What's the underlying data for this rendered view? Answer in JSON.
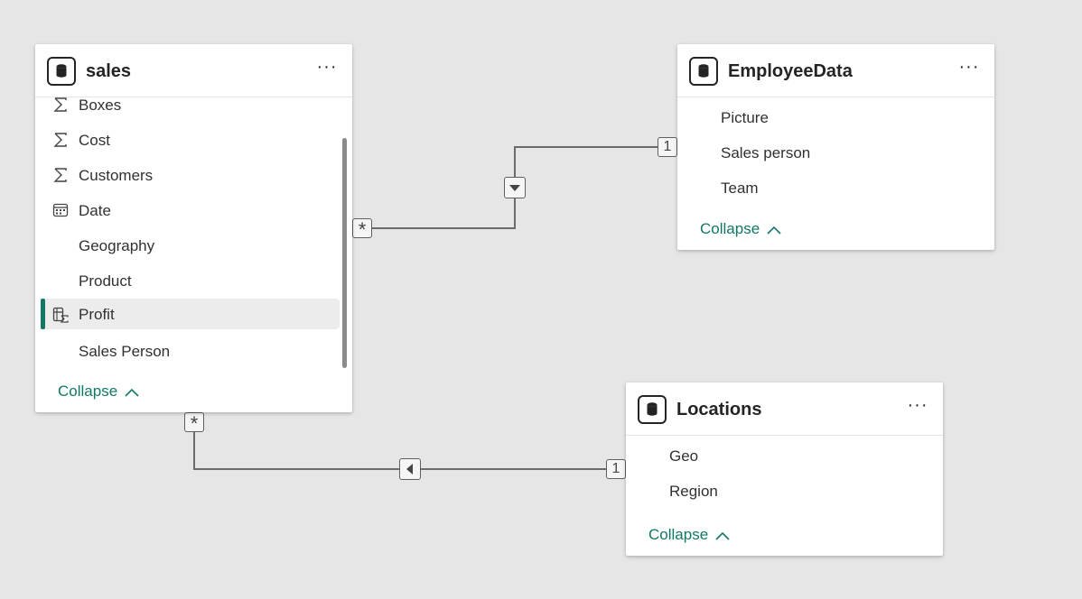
{
  "tables": {
    "sales": {
      "title": "sales",
      "more": "···",
      "fields": [
        {
          "label": "Boxes",
          "icon": "sigma-icon"
        },
        {
          "label": "Cost",
          "icon": "sigma-icon"
        },
        {
          "label": "Customers",
          "icon": "sigma-icon"
        },
        {
          "label": "Date",
          "icon": "calendar-icon"
        },
        {
          "label": "Geography",
          "icon": ""
        },
        {
          "label": "Product",
          "icon": ""
        },
        {
          "label": "Profit",
          "icon": "calculated-column-icon"
        },
        {
          "label": "Sales Person",
          "icon": ""
        }
      ],
      "selected_field": "Profit",
      "collapse_label": "Collapse"
    },
    "employee": {
      "title": "EmployeeData",
      "more": "···",
      "fields": [
        {
          "label": "Picture"
        },
        {
          "label": "Sales person"
        },
        {
          "label": "Team"
        }
      ],
      "collapse_label": "Collapse"
    },
    "locations": {
      "title": "Locations",
      "more": "···",
      "fields": [
        {
          "label": "Geo"
        },
        {
          "label": "Region"
        }
      ],
      "collapse_label": "Collapse"
    }
  },
  "relationships": [
    {
      "from": "sales",
      "to": "EmployeeData",
      "from_cardinality": "*",
      "to_cardinality": "1",
      "filter_direction": "down-arrow-icon"
    },
    {
      "from": "sales",
      "to": "Locations",
      "from_cardinality": "*",
      "to_cardinality": "1",
      "filter_direction": "left-arrow-icon"
    }
  ],
  "colors": {
    "background": "#e6e6e6",
    "accent": "#117865",
    "line": "#6b6b6b",
    "text": "#252423"
  }
}
